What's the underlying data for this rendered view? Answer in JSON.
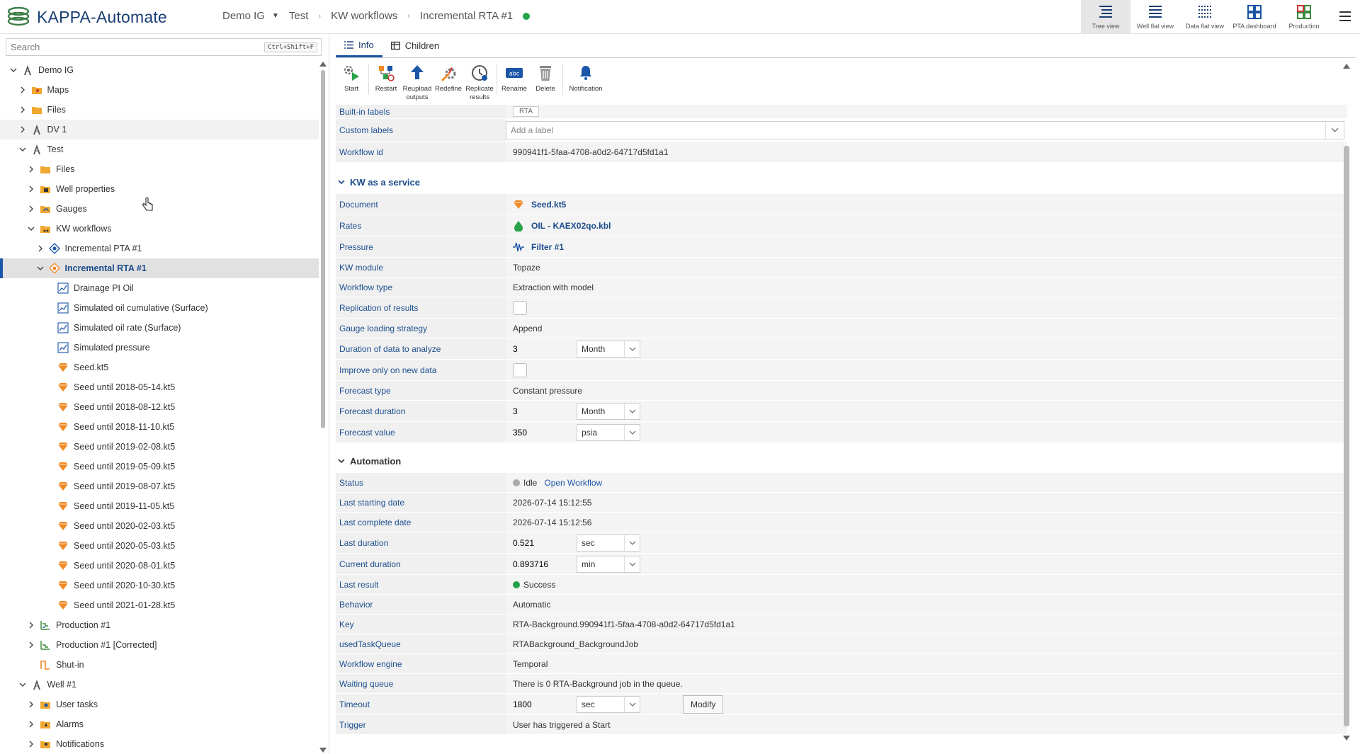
{
  "app": {
    "title": "KAPPA-Automate"
  },
  "breadcrumb": {
    "items": [
      "Demo IG",
      "Test",
      "KW workflows",
      "Incremental RTA #1"
    ],
    "status_color": "#22a34a"
  },
  "views": [
    {
      "label": "Tree view",
      "icon": "tree-view-icon"
    },
    {
      "label": "Well flat view",
      "icon": "well-flat-view-icon"
    },
    {
      "label": "Data flat view",
      "icon": "data-flat-view-icon"
    },
    {
      "label": "PTA dashboard",
      "icon": "pta-dashboard-icon"
    },
    {
      "label": "Production",
      "icon": "production-icon"
    }
  ],
  "search": {
    "placeholder": "Search",
    "shortcut": "Ctrl+Shift+F"
  },
  "tree": [
    {
      "label": "Demo IG",
      "indent": 0,
      "chev": "down",
      "icon": "well-tower-icon"
    },
    {
      "label": "Maps",
      "indent": 1,
      "chev": "right",
      "icon": "maps-folder-icon"
    },
    {
      "label": "Files",
      "indent": 1,
      "chev": "right",
      "icon": "folder-icon"
    },
    {
      "label": "DV 1",
      "indent": 1,
      "chev": "right",
      "icon": "well-tower-icon",
      "hover": true
    },
    {
      "label": "Test",
      "indent": 1,
      "chev": "down",
      "icon": "well-tower-icon"
    },
    {
      "label": "Files",
      "indent": 2,
      "chev": "right",
      "icon": "folder-icon"
    },
    {
      "label": "Well properties",
      "indent": 2,
      "chev": "right",
      "icon": "properties-folder-icon"
    },
    {
      "label": "Gauges",
      "indent": 2,
      "chev": "right",
      "icon": "gauges-folder-icon"
    },
    {
      "label": "KW workflows",
      "indent": 2,
      "chev": "down",
      "icon": "workflows-folder-icon"
    },
    {
      "label": "Incremental PTA #1",
      "indent": 3,
      "chev": "right",
      "icon": "pta-workflow-icon"
    },
    {
      "label": "Incremental RTA #1",
      "indent": 3,
      "chev": "down",
      "icon": "rta-workflow-icon",
      "selected": true
    },
    {
      "label": "Drainage PI Oil",
      "indent": 4,
      "chev": "",
      "icon": "line-chart-icon"
    },
    {
      "label": "Simulated oil cumulative (Surface)",
      "indent": 4,
      "chev": "",
      "icon": "line-chart-icon"
    },
    {
      "label": "Simulated oil rate (Surface)",
      "indent": 4,
      "chev": "",
      "icon": "line-chart-icon"
    },
    {
      "label": "Simulated pressure",
      "indent": 4,
      "chev": "",
      "icon": "line-chart-icon"
    },
    {
      "label": "Seed.kt5",
      "indent": 4,
      "chev": "",
      "icon": "kt5-file-icon"
    },
    {
      "label": "Seed until 2018-05-14.kt5",
      "indent": 4,
      "chev": "",
      "icon": "kt5-file-icon"
    },
    {
      "label": "Seed until 2018-08-12.kt5",
      "indent": 4,
      "chev": "",
      "icon": "kt5-file-icon"
    },
    {
      "label": "Seed until 2018-11-10.kt5",
      "indent": 4,
      "chev": "",
      "icon": "kt5-file-icon"
    },
    {
      "label": "Seed until 2019-02-08.kt5",
      "indent": 4,
      "chev": "",
      "icon": "kt5-file-icon"
    },
    {
      "label": "Seed until 2019-05-09.kt5",
      "indent": 4,
      "chev": "",
      "icon": "kt5-file-icon"
    },
    {
      "label": "Seed until 2019-08-07.kt5",
      "indent": 4,
      "chev": "",
      "icon": "kt5-file-icon"
    },
    {
      "label": "Seed until 2019-11-05.kt5",
      "indent": 4,
      "chev": "",
      "icon": "kt5-file-icon"
    },
    {
      "label": "Seed until 2020-02-03.kt5",
      "indent": 4,
      "chev": "",
      "icon": "kt5-file-icon"
    },
    {
      "label": "Seed until 2020-05-03.kt5",
      "indent": 4,
      "chev": "",
      "icon": "kt5-file-icon"
    },
    {
      "label": "Seed until 2020-08-01.kt5",
      "indent": 4,
      "chev": "",
      "icon": "kt5-file-icon"
    },
    {
      "label": "Seed until 2020-10-30.kt5",
      "indent": 4,
      "chev": "",
      "icon": "kt5-file-icon"
    },
    {
      "label": "Seed until 2021-01-28.kt5",
      "indent": 4,
      "chev": "",
      "icon": "kt5-file-icon"
    },
    {
      "label": "Production #1",
      "indent": 2,
      "chev": "right",
      "icon": "production-chart-icon"
    },
    {
      "label": "Production #1 [Corrected]",
      "indent": 2,
      "chev": "right",
      "icon": "production-corrected-icon"
    },
    {
      "label": "Shut-in",
      "indent": 2,
      "chev": "",
      "icon": "shut-in-icon"
    },
    {
      "label": "Well #1",
      "indent": 1,
      "chev": "down",
      "icon": "well-tower-icon"
    },
    {
      "label": "User tasks",
      "indent": 2,
      "chev": "right",
      "icon": "tasks-folder-icon"
    },
    {
      "label": "Alarms",
      "indent": 2,
      "chev": "right",
      "icon": "alarms-folder-icon"
    },
    {
      "label": "Notifications",
      "indent": 2,
      "chev": "right",
      "icon": "notifications-folder-icon"
    }
  ],
  "tabs": [
    {
      "label": "Info",
      "icon": "list-icon",
      "active": true
    },
    {
      "label": "Children",
      "icon": "table-icon",
      "active": false
    }
  ],
  "toolbar": [
    {
      "label": "Start",
      "icon": "start-icon"
    },
    {
      "label": "Restart",
      "icon": "restart-icon"
    },
    {
      "label": "Reupload outputs",
      "icon": "reupload-icon"
    },
    {
      "label": "Redefine",
      "icon": "redefine-icon"
    },
    {
      "label": "Replicate results",
      "icon": "replicate-icon"
    },
    {
      "label": "Rename",
      "icon": "rename-icon"
    },
    {
      "label": "Delete",
      "icon": "delete-icon"
    },
    {
      "label": "Notification",
      "icon": "bell-icon"
    }
  ],
  "info": {
    "builtin_labels": {
      "label": "Built-in labels",
      "value": "RTA"
    },
    "custom_labels": {
      "label": "Custom labels",
      "placeholder": "Add a label"
    },
    "workflow_id": {
      "label": "Workflow id",
      "value": "990941f1-5faa-4708-a0d2-64717d5fd1a1"
    }
  },
  "kw_service": {
    "title": "KW as a service",
    "document": {
      "label": "Document",
      "value": "Seed.kt5"
    },
    "rates": {
      "label": "Rates",
      "value": "OIL - KAEX02qo.kbl"
    },
    "pressure": {
      "label": "Pressure",
      "value": "Filter #1"
    },
    "kw_module": {
      "label": "KW module",
      "value": "Topaze"
    },
    "workflow_type": {
      "label": "Workflow type",
      "value": "Extraction with model"
    },
    "replication": {
      "label": "Replication of results"
    },
    "gauge_strategy": {
      "label": "Gauge loading strategy",
      "value": "Append"
    },
    "duration": {
      "label": "Duration of data to analyze",
      "value": "3",
      "unit": "Month"
    },
    "improve": {
      "label": "Improve only on new data"
    },
    "forecast_type": {
      "label": "Forecast type",
      "value": "Constant pressure"
    },
    "forecast_duration": {
      "label": "Forecast duration",
      "value": "3",
      "unit": "Month"
    },
    "forecast_value": {
      "label": "Forecast value",
      "value": "350",
      "unit": "psia"
    }
  },
  "automation": {
    "title": "Automation",
    "status": {
      "label": "Status",
      "value": "Idle",
      "link": "Open Workflow"
    },
    "last_starting": {
      "label": "Last starting date",
      "value": "2026-07-14 15:12:55"
    },
    "last_complete": {
      "label": "Last complete date",
      "value": "2026-07-14 15:12:56"
    },
    "last_duration": {
      "label": "Last duration",
      "value": "0.521",
      "unit": "sec"
    },
    "current_duration": {
      "label": "Current duration",
      "value": "0.893716",
      "unit": "min"
    },
    "last_result": {
      "label": "Last result",
      "value": "Success"
    },
    "behavior": {
      "label": "Behavior",
      "value": "Automatic"
    },
    "key": {
      "label": "Key",
      "value": "RTA-Background.990941f1-5faa-4708-a0d2-64717d5fd1a1"
    },
    "task_queue": {
      "label": "usedTaskQueue",
      "value": "RTABackground_BackgroundJob"
    },
    "engine": {
      "label": "Workflow engine",
      "value": "Temporal"
    },
    "waiting": {
      "label": "Waiting queue",
      "value": "There is 0 RTA-Background job in the queue."
    },
    "timeout": {
      "label": "Timeout",
      "value": "1800",
      "unit": "sec",
      "button": "Modify"
    },
    "trigger": {
      "label": "Trigger",
      "value": "User has triggered a Start"
    }
  },
  "colors": {
    "accent": "#1b56a8",
    "label_blue": "#1d4f8f",
    "success": "#22a34a",
    "idle": "#999999",
    "kt5_orange": "#f08a24"
  }
}
